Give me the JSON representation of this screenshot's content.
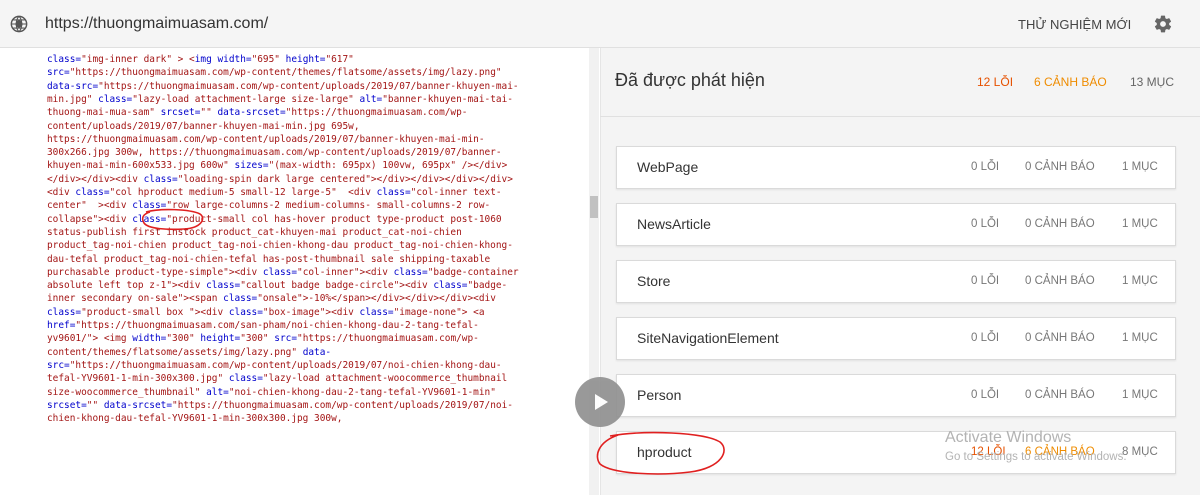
{
  "browser": {
    "url": "https://thuongmaimuasam.com/",
    "new_test_label": "THỬ NGHIỆM MỚI",
    "globe_icon": "globe-icon",
    "settings_icon": "gear-icon"
  },
  "code": {
    "lines": [
      [
        {
          "t": "class=",
          "k": 1
        },
        {
          "t": "\"img-inner dark\" > <"
        },
        {
          "t": "img ",
          "k": 1
        },
        {
          "t": "width=",
          "k": 1
        },
        {
          "t": "\"695\" "
        },
        {
          "t": "height=",
          "k": 1
        },
        {
          "t": "\"617\""
        }
      ],
      [
        {
          "t": "src=",
          "k": 1
        },
        {
          "t": "\"https://thuongmaimuasam.com/wp-content/themes/flatsome/assets/img/lazy.png\""
        }
      ],
      [
        {
          "t": "data-src=",
          "k": 1
        },
        {
          "t": "\"https://thuongmaimuasam.com/wp-content/uploads/2019/07/banner-khuyen-mai-"
        }
      ],
      [
        {
          "t": "min.jpg\" "
        },
        {
          "t": "class=",
          "k": 1
        },
        {
          "t": "\"lazy-load attachment-large size-large\" "
        },
        {
          "t": "alt=",
          "k": 1
        },
        {
          "t": "\"banner-khuyen-mai-tai-"
        }
      ],
      [
        {
          "t": "thuong-mai-mua-sam\" "
        },
        {
          "t": "srcset=",
          "k": 1
        },
        {
          "t": "\"\" "
        },
        {
          "t": "data-srcset=",
          "k": 1
        },
        {
          "t": "\"https://thuongmaimuasam.com/wp-"
        }
      ],
      [
        {
          "t": "content/uploads/2019/07/banner-khuyen-mai-min.jpg 695w,"
        }
      ],
      [
        {
          "t": "https://thuongmaimuasam.com/wp-content/uploads/2019/07/banner-khuyen-mai-min-"
        }
      ],
      [
        {
          "t": "300x266.jpg 300w, https://thuongmaimuasam.com/wp-content/uploads/2019/07/banner-"
        }
      ],
      [
        {
          "t": "khuyen-mai-min-600x533.jpg 600w\" "
        },
        {
          "t": "sizes=",
          "k": 1
        },
        {
          "t": "\"(max-width: 695px) 100vw, 695px\" /></div>"
        }
      ],
      [
        {
          "t": "</div></div><div "
        },
        {
          "t": "class=",
          "k": 1
        },
        {
          "t": "\"loading-spin dark large centered\"></div></div></div></div>"
        }
      ],
      [
        {
          "t": "<div "
        },
        {
          "t": "class=",
          "k": 1
        },
        {
          "t": "\"col hproduct medium-5 small-12 large-5\"  <div "
        },
        {
          "t": "class=",
          "k": 1
        },
        {
          "t": "\"col-inner text-"
        }
      ],
      [
        {
          "t": "center\"  ><div "
        },
        {
          "t": "class=",
          "k": 1
        },
        {
          "t": "\"row large-columns-2 medium-columns- small-columns-2 row-"
        }
      ],
      [
        {
          "t": "collapse\"><div "
        },
        {
          "t": "class=",
          "k": 1
        },
        {
          "t": "\"product-small col has-hover product type-product post-1060"
        }
      ],
      [
        {
          "t": "status-publish first instock product_cat-khuyen-mai product_cat-noi-chien"
        }
      ],
      [
        {
          "t": "product_tag-noi-chien product_tag-noi-chien-khong-dau product_tag-noi-chien-khong-"
        }
      ],
      [
        {
          "t": "dau-tefal product_tag-noi-chien-tefal has-post-thumbnail sale shipping-taxable"
        }
      ],
      [
        {
          "t": "purchasable product-type-simple\"><div "
        },
        {
          "t": "class=",
          "k": 1
        },
        {
          "t": "\"col-inner\"><div "
        },
        {
          "t": "class=",
          "k": 1
        },
        {
          "t": "\"badge-container"
        }
      ],
      [
        {
          "t": "absolute left top z-1\"><div "
        },
        {
          "t": "class=",
          "k": 1
        },
        {
          "t": "\"callout badge badge-circle\"><div "
        },
        {
          "t": "class=",
          "k": 1
        },
        {
          "t": "\"badge-"
        }
      ],
      [
        {
          "t": "inner secondary on-sale\"><span "
        },
        {
          "t": "class=",
          "k": 1
        },
        {
          "t": "\"onsale\">-10%</span></div></div></div><div"
        }
      ],
      [
        {
          "t": "class=",
          "k": 1
        },
        {
          "t": "\"product-small box \"><div "
        },
        {
          "t": "class=",
          "k": 1
        },
        {
          "t": "\"box-image\"><div "
        },
        {
          "t": "class=",
          "k": 1
        },
        {
          "t": "\"image-none\"> <a"
        }
      ],
      [
        {
          "t": "href=",
          "k": 1
        },
        {
          "t": "\"https://thuongmaimuasam.com/san-pham/noi-chien-khong-dau-2-tang-tefal-"
        }
      ],
      [
        {
          "t": "yv9601/\"> <img "
        },
        {
          "t": "width=",
          "k": 1
        },
        {
          "t": "\"300\" "
        },
        {
          "t": "height=",
          "k": 1
        },
        {
          "t": "\"300\" "
        },
        {
          "t": "src=",
          "k": 1
        },
        {
          "t": "\"https://thuongmaimuasam.com/wp-"
        }
      ],
      [
        {
          "t": "content/themes/flatsome/assets/img/lazy.png\" "
        },
        {
          "t": "data-",
          "k": 1
        }
      ],
      [
        {
          "t": "src=",
          "k": 1
        },
        {
          "t": "\"https://thuongmaimuasam.com/wp-content/uploads/2019/07/noi-chien-khong-dau-"
        }
      ],
      [
        {
          "t": "tefal-YV9601-1-min-300x300.jpg\" "
        },
        {
          "t": "class=",
          "k": 1
        },
        {
          "t": "\"lazy-load attachment-woocommerce_thumbnail"
        }
      ],
      [
        {
          "t": "size-woocommerce_thumbnail\" "
        },
        {
          "t": "alt=",
          "k": 1
        },
        {
          "t": "\"noi-chien-khong-dau-2-tang-tefal-YV9601-1-min\""
        }
      ],
      [
        {
          "t": "srcset=",
          "k": 1
        },
        {
          "t": "\"\" "
        },
        {
          "t": "data-srcset=",
          "k": 1
        },
        {
          "t": "\"https://thuongmaimuasam.com/wp-content/uploads/2019/07/noi-"
        }
      ],
      [
        {
          "t": "chien-khong-dau-tefal-YV9601-1-min-300x300.jpg 300w,"
        }
      ]
    ]
  },
  "summary": {
    "title": "Đã được phát hiện",
    "errors": "12 LỖI",
    "warnings": "6 CẢNH BÁO",
    "items": "13 MỤC"
  },
  "cards": [
    {
      "name": "WebPage",
      "errors": "0 LỖI",
      "warnings": "0 CẢNH BÁO",
      "items": "1 MỤC",
      "has_errors": false
    },
    {
      "name": "NewsArticle",
      "errors": "0 LỖI",
      "warnings": "0 CẢNH BÁO",
      "items": "1 MỤC",
      "has_errors": false
    },
    {
      "name": "Store",
      "errors": "0 LỖI",
      "warnings": "0 CẢNH BÁO",
      "items": "1 MỤC",
      "has_errors": false
    },
    {
      "name": "SiteNavigationElement",
      "errors": "0 LỖI",
      "warnings": "0 CẢNH BÁO",
      "items": "1 MỤC",
      "has_errors": false
    },
    {
      "name": "Person",
      "errors": "0 LỖI",
      "warnings": "0 CẢNH BÁO",
      "items": "1 MỤC",
      "has_errors": false
    },
    {
      "name": "hproduct",
      "errors": "12 LỖI",
      "warnings": "6 CẢNH BÁO",
      "items": "8 MỤC",
      "has_errors": true
    }
  ],
  "overlay": {
    "play_icon": "play-icon",
    "watermark_line1": "Activate Windows",
    "watermark_line2": "Go to Settings to activate Windows.",
    "annotation_color": "#e02020"
  },
  "colors": {
    "error": "#e65100",
    "warning": "#ef8c00",
    "keyword": "#0000cc",
    "string": "#a31515"
  }
}
